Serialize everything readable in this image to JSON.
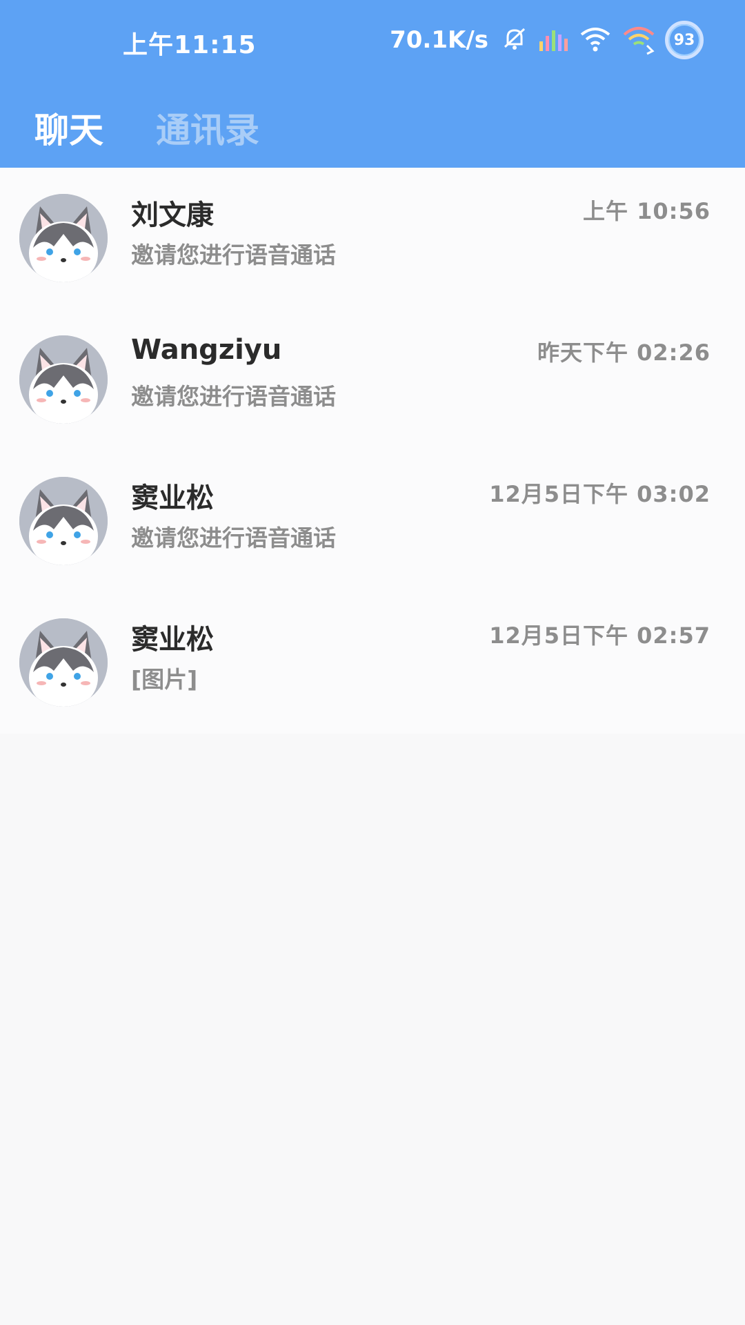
{
  "status_bar": {
    "time": "上午11:15",
    "net_speed": "70.1K/s",
    "battery": "93"
  },
  "tabs": [
    {
      "label": "聊天",
      "active": true
    },
    {
      "label": "通讯录",
      "active": false
    }
  ],
  "colors": {
    "header_bg": "#5da2f4",
    "active_tab": "#ffffff",
    "inactive_tab": "#a9cdf7",
    "name_text": "#2b2b2b",
    "secondary_text": "#8d8d8d"
  },
  "chats": [
    {
      "name": "刘文康",
      "preview": "邀请您进行语音通话",
      "time": "上午 10:56",
      "avatar_icon": "husky-avatar-icon"
    },
    {
      "name": "Wangziyu",
      "preview": "邀请您进行语音通话",
      "time": "昨天下午 02:26",
      "avatar_icon": "husky-avatar-icon"
    },
    {
      "name": "窦业松",
      "preview": "邀请您进行语音通话",
      "time": "12月5日下午 03:02",
      "avatar_icon": "husky-avatar-icon"
    },
    {
      "name": "窦业松",
      "preview": "[图片]",
      "time": "12月5日下午 02:57",
      "avatar_icon": "husky-avatar-icon"
    }
  ]
}
